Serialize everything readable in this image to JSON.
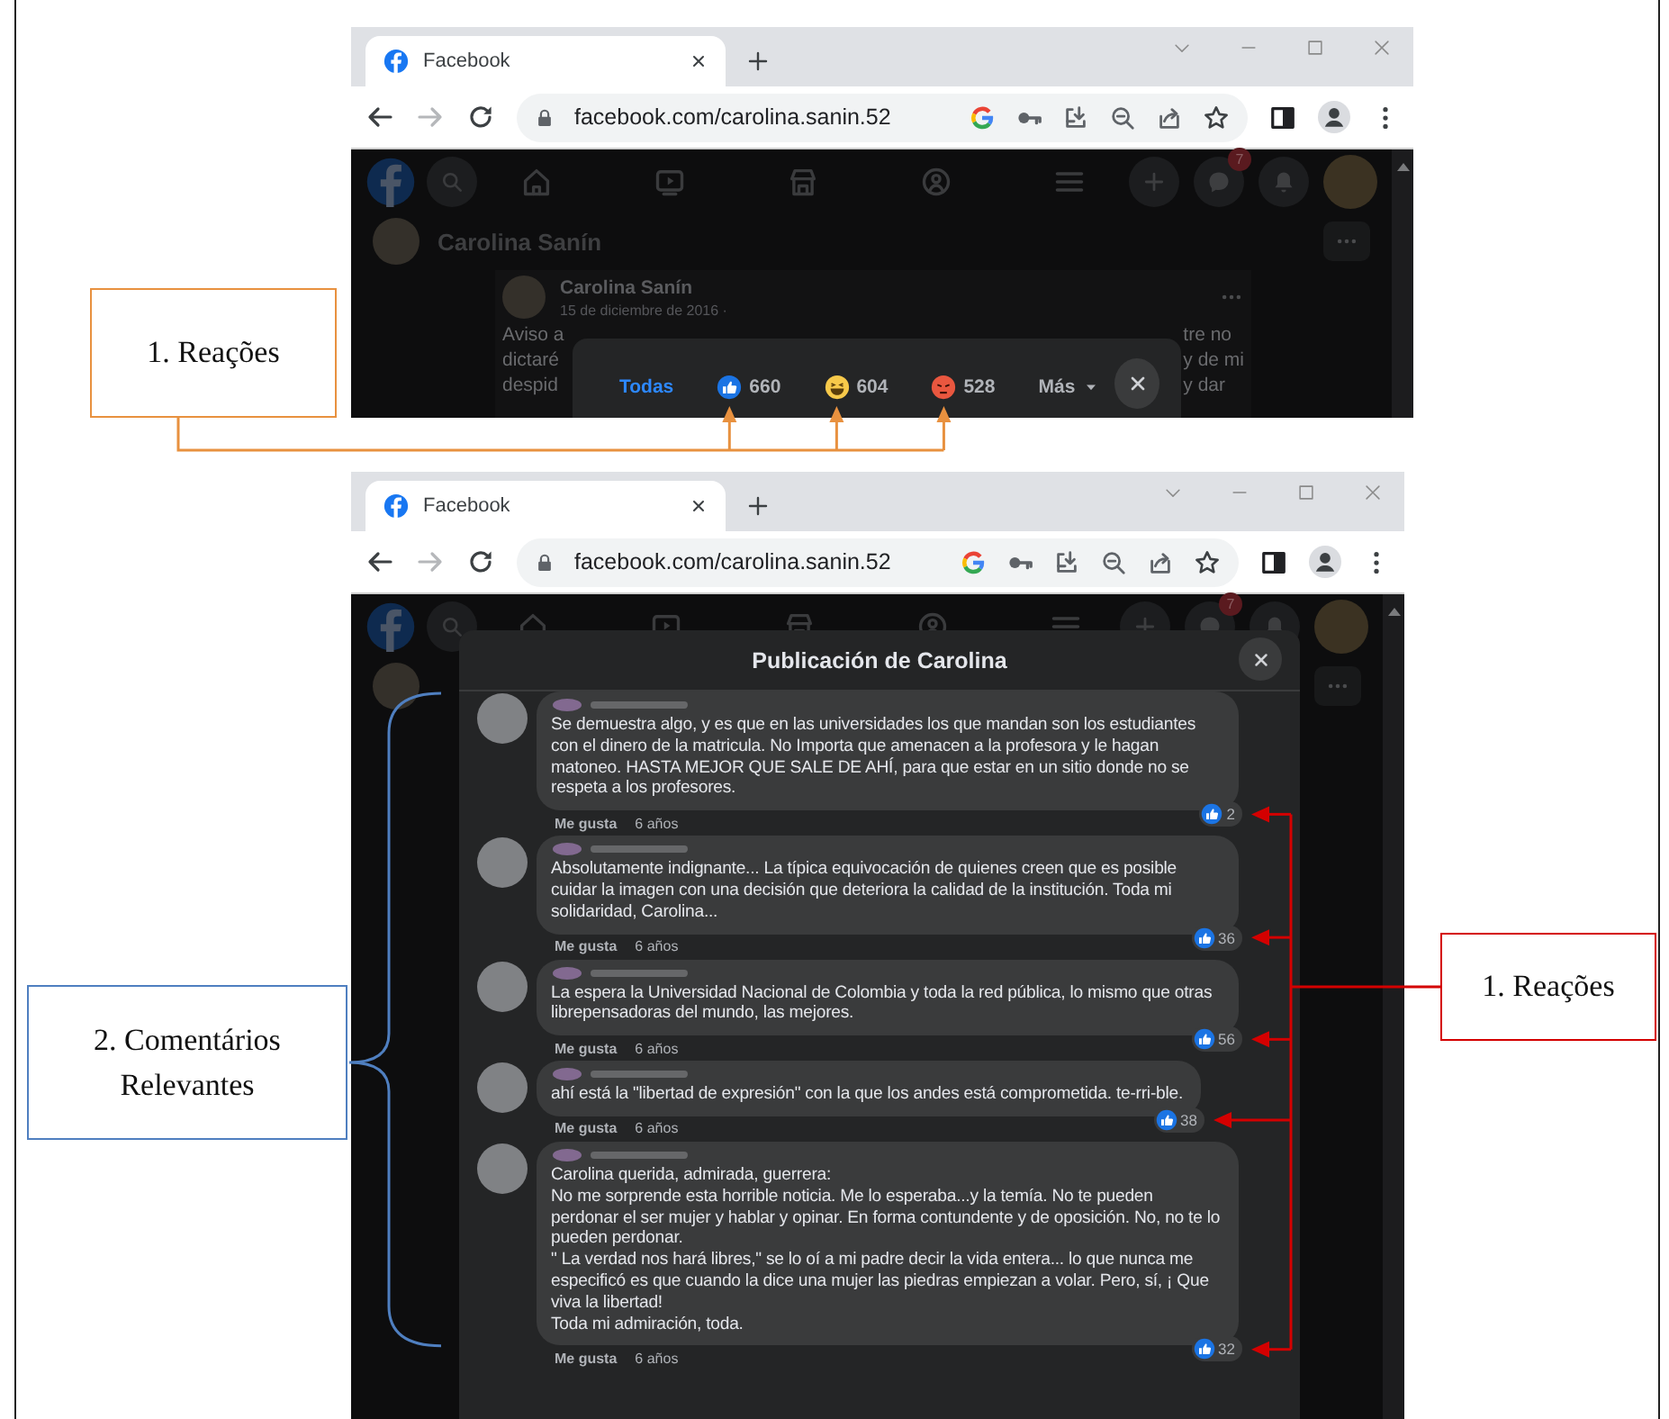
{
  "figure": {
    "screenshots": [
      {
        "kind": "reactions",
        "browser": {
          "tab_title": "Facebook",
          "address": "facebook.com/carolina.sanin.52"
        },
        "notification_badge": "7",
        "profile_name": "Carolina Sanín",
        "post": {
          "author": "Carolina Sanín",
          "date": "15 de diciembre de 2016 ·",
          "text_left": [
            "Aviso a",
            "dictaré",
            "despid"
          ],
          "text_right": [
            "tre no",
            "y de mi",
            "y dar"
          ]
        },
        "reactions_popup": {
          "tabs": [
            {
              "kind": "all",
              "label": "Todas",
              "selected": true
            },
            {
              "kind": "like",
              "label": "660",
              "selected": false
            },
            {
              "kind": "haha",
              "label": "604",
              "selected": false
            },
            {
              "kind": "angry",
              "label": "528",
              "selected": false
            },
            {
              "kind": "more",
              "label": "Más",
              "selected": false
            }
          ]
        }
      },
      {
        "kind": "comments",
        "browser": {
          "tab_title": "Facebook",
          "address": "facebook.com/carolina.sanin.52"
        },
        "notification_badge": "7",
        "dialog": {
          "title": "Publicación de Carolina",
          "comments": [
            {
              "text": "Se demuestra algo, y es que en las universidades los que mandan son los estudiantes con el dinero de la matricula. No Importa que amenacen a la profesora y le hagan matoneo. HASTA MEJOR QUE SALE DE AHÍ, para que estar en un sitio donde no se respeta a los profesores.",
              "like_label": "Me gusta",
              "age": "6 años",
              "reaction_count": "2"
            },
            {
              "text": "Absolutamente indignante... La típica equivocación de quienes creen que es posible cuidar la imagen con una decisión que deteriora la calidad de la institución. Toda mi solidaridad, Carolina...",
              "like_label": "Me gusta",
              "age": "6 años",
              "reaction_count": "36"
            },
            {
              "text": "La espera la Universidad Nacional de Colombia y toda la red pública, lo mismo que otras librepensadoras del mundo, las mejores.",
              "like_label": "Me gusta",
              "age": "6 años",
              "reaction_count": "56"
            },
            {
              "text": "ahí está la \"libertad de expresión\" con la que los andes está comprometida. te-rri-ble.",
              "like_label": "Me gusta",
              "age": "6 años",
              "reaction_count": "38"
            },
            {
              "text": "Carolina querida, admirada, guerrera:\nNo me sorprende esta horrible noticia. Me lo esperaba...y la temía. No te pueden perdonar el ser mujer y hablar y opinar. En forma contundente y de oposición. No, no te lo pueden perdonar.\n\" La verdad nos hará libres,\" se lo oí a mi padre decir la vida entera... lo que nunca me especificó es que cuando la dice una mujer las piedras empiezan a volar. Pero, sí, ¡ Que viva la libertad!\nToda mi admiración, toda.",
              "like_label": "Me gusta",
              "age": "6 años",
              "reaction_count": "32"
            }
          ]
        }
      }
    ],
    "callouts": [
      {
        "kind": "top",
        "label": "1. Reações",
        "color": "#e8913f"
      },
      {
        "kind": "brace",
        "label": "2. Comentários Relevantes",
        "color": "#4f7fc0"
      },
      {
        "kind": "side",
        "label": "1. Reações",
        "color": "#d40000"
      }
    ]
  }
}
